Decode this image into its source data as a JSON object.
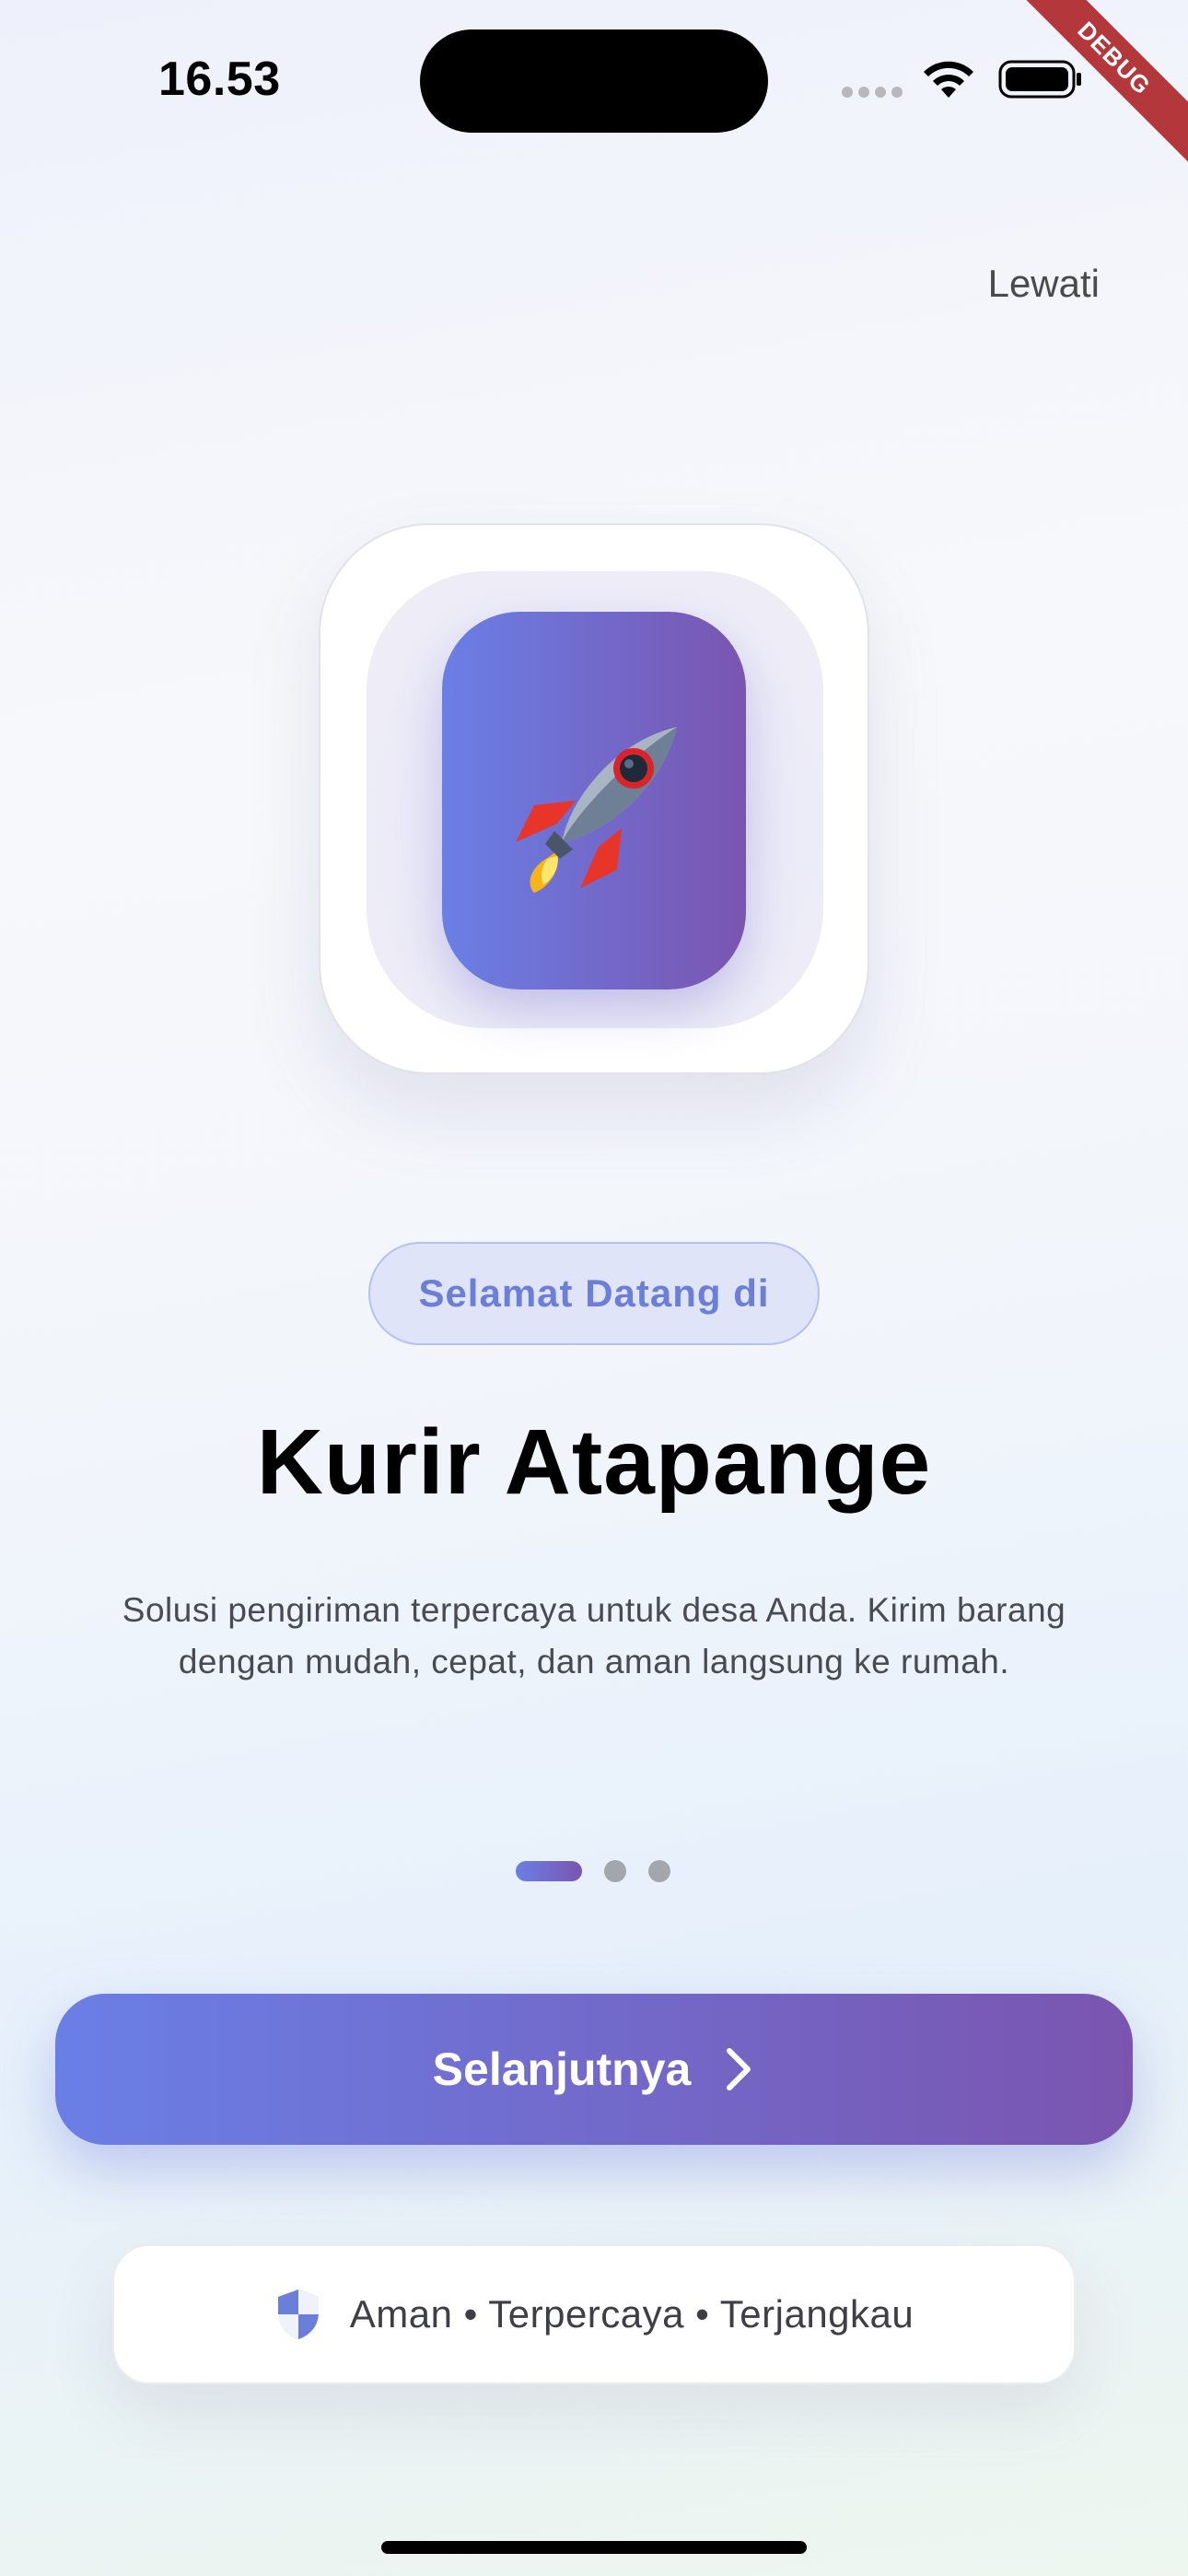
{
  "status_bar": {
    "time": "16.53",
    "debug_banner": "DEBUG"
  },
  "header": {
    "skip_label": "Lewati"
  },
  "hero": {
    "icon": "rocket-icon",
    "emoji": "🚀"
  },
  "onboarding": {
    "welcome_chip": "Selamat Datang di",
    "title": "Kurir Atapange",
    "description": "Solusi pengiriman terpercaya untuk desa Anda. Kirim barang dengan mudah, cepat, dan aman langsung ke rumah.",
    "current_page": 1,
    "page_count": 3
  },
  "actions": {
    "next_label": "Selanjutnya"
  },
  "trust": {
    "icon": "shield-icon",
    "text": "Aman • Terpercaya • Terjangkau"
  },
  "colors": {
    "gradient_start": "#6a7fe6",
    "gradient_end": "#7a55b0",
    "chip_text": "#6b7fd8",
    "debug_banner": "#b3373b"
  }
}
